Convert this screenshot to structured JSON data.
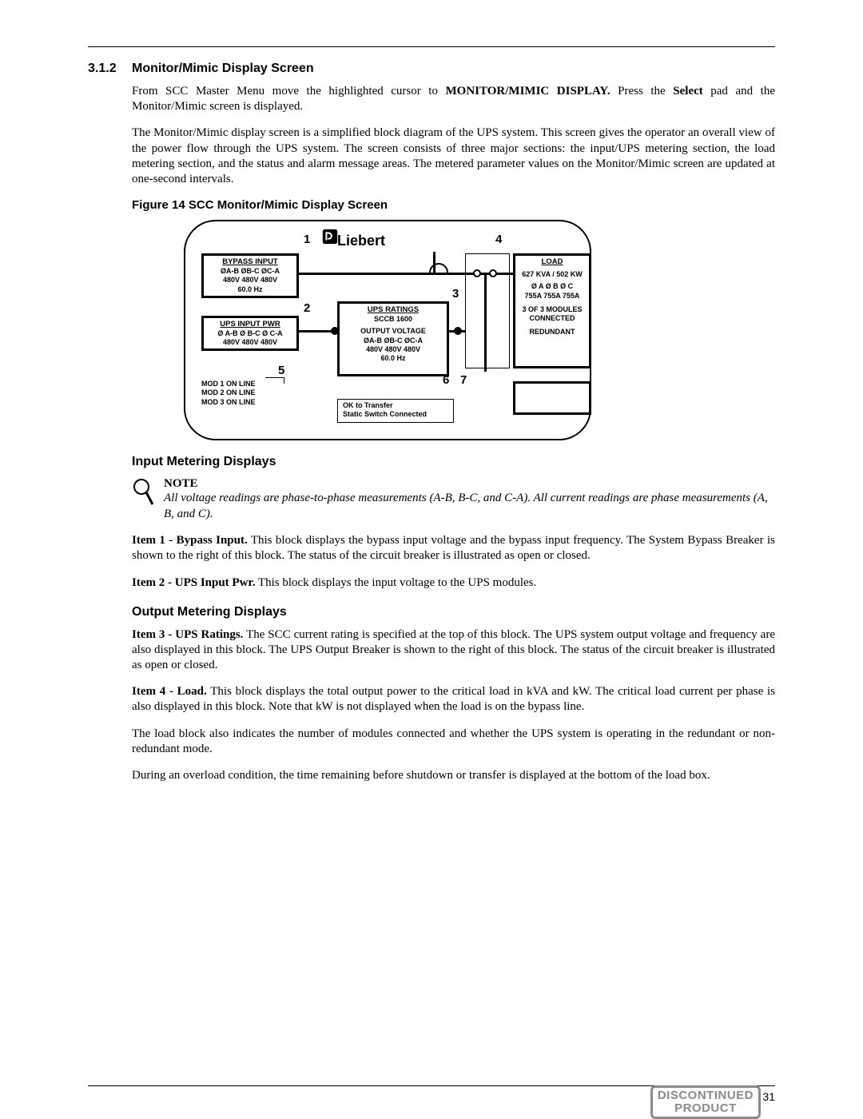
{
  "heading": {
    "number": "3.1.2",
    "title": "Monitor/Mimic Display Screen"
  },
  "intro1_a": "From SCC Master Menu move the highlighted cursor to ",
  "intro1_b": "MONITOR/MIMIC DISPLAY.",
  "intro1_c": " Press the ",
  "intro1_d": "Select",
  "intro1_e": " pad and the Monitor/Mimic screen is displayed.",
  "intro2": "The Monitor/Mimic display screen is a simplified block diagram of the UPS system. This screen gives the operator an overall view of the power flow through the UPS system. The screen consists of three major sections: the input/UPS metering section, the load metering section, and the status and alarm message areas. The metered parameter values on the Monitor/Mimic screen are updated at one-second intervals.",
  "figure_caption": "Figure 14  SCC Monitor/Mimic Display Screen",
  "diagram": {
    "brand": "Liebert",
    "nums": {
      "n1": "1",
      "n2": "2",
      "n3": "3",
      "n4": "4",
      "n5": "5",
      "n6": "6",
      "n7": "7"
    },
    "bypass": {
      "title": "BYPASS INPUT",
      "row1": "ØA-B   ØB-C  ØC-A",
      "row2": "480V   480V   480V",
      "row3": "60.0 Hz"
    },
    "upsin": {
      "title": "UPS INPUT PWR",
      "row1": "Ø A-B  Ø B-C  Ø C-A",
      "row2": "480V   480V   480V"
    },
    "ratings": {
      "title": "UPS RATINGS",
      "row1": "SCCB 1600",
      "row2": "OUTPUT VOLTAGE",
      "row3": "ØA-B  ØB-C  ØC-A",
      "row4": "480V   480V   480V",
      "row5": "60.0 Hz"
    },
    "load": {
      "title": "LOAD",
      "row1": "627 KVA / 502 KW",
      "row2": "Ø A     Ø B     Ø C",
      "row3": "755A   755A   755A",
      "row4": "3 OF 3 MODULES",
      "row5": "CONNECTED",
      "row6": "REDUNDANT"
    },
    "mods": {
      "m1": "MOD 1  ON LINE",
      "m2": "MOD 2  ON LINE",
      "m3": "MOD 3  ON LINE"
    },
    "status": {
      "l1": "OK to Transfer",
      "l2": "Static Switch Connected"
    }
  },
  "sub_input": "Input Metering Displays",
  "note_title": "NOTE",
  "note_body": "All voltage readings are phase-to-phase measurements (A-B, B-C, and C-A). All current readings are phase measurements (A, B, and C).",
  "item1_lead": "Item 1 - Bypass Input.",
  "item1_body": " This block displays the bypass input voltage and the bypass input frequency. The System Bypass Breaker is shown to the right of this block. The status of the circuit breaker is illustrated as open or closed.",
  "item2_lead": "Item 2 - UPS Input Pwr.",
  "item2_body": " This block displays the input voltage to the UPS modules.",
  "sub_output": "Output Metering Displays",
  "item3_lead": "Item 3 - UPS Ratings.",
  "item3_body": " The SCC current rating is specified at the top of this block. The UPS system output voltage and frequency are also displayed in this block. The UPS Output Breaker is shown to the right of this block. The status of the circuit breaker is illustrated as open or closed.",
  "item4_lead": "Item 4 - Load.",
  "item4_body": " This block displays the total output power to the critical load in kVA and kW. The critical load current per phase is also displayed in this block. Note that kW is not displayed when the load is on the bypass line.",
  "para5": "The load block also indicates the number of modules connected and whether the UPS system is operating in the redundant or non-redundant mode.",
  "para6": "During an overload condition, the time remaining before shutdown or transfer is displayed at the bottom of the load box.",
  "page_number": "31",
  "stamp_l1": "DISCONTINUED",
  "stamp_l2": "PRODUCT"
}
